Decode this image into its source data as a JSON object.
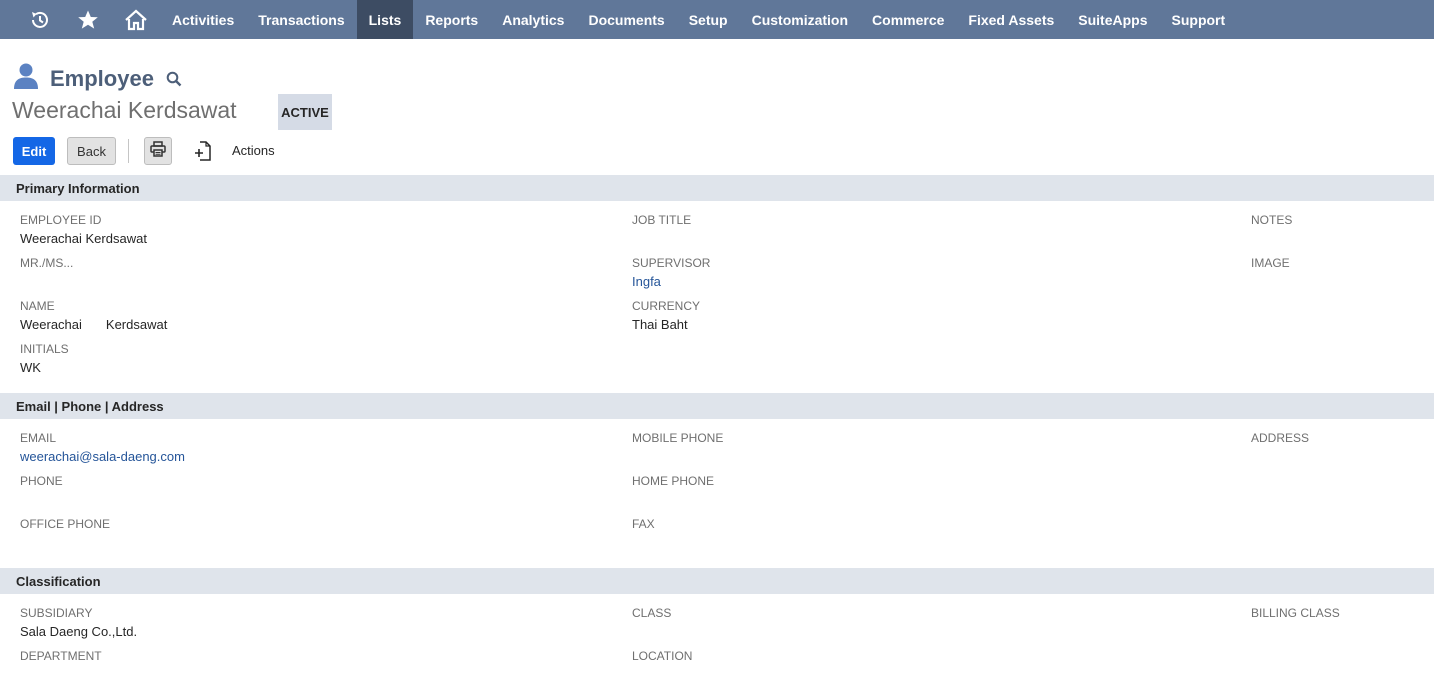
{
  "nav": {
    "icons": [
      "recent-icon",
      "star-icon",
      "home-icon"
    ],
    "items": [
      "Activities",
      "Transactions",
      "Lists",
      "Reports",
      "Analytics",
      "Documents",
      "Setup",
      "Customization",
      "Commerce",
      "Fixed Assets",
      "SuiteApps",
      "Support"
    ],
    "active": "Lists"
  },
  "record": {
    "type": "Employee",
    "name": "Weerachai Kerdsawat",
    "status": "ACTIVE"
  },
  "buttons": {
    "edit": "Edit",
    "back": "Back",
    "actions": "Actions"
  },
  "sections": {
    "primary": {
      "title": "Primary Information",
      "employee_id_label": "EMPLOYEE ID",
      "employee_id_value": "Weerachai Kerdsawat",
      "mr_ms_label": "MR./MS...",
      "name_label": "NAME",
      "first_name": "Weerachai",
      "last_name": "Kerdsawat",
      "initials_label": "INITIALS",
      "initials_value": "WK",
      "job_title_label": "JOB TITLE",
      "supervisor_label": "SUPERVISOR",
      "supervisor_value": "Ingfa",
      "currency_label": "CURRENCY",
      "currency_value": "Thai Baht",
      "notes_label": "NOTES",
      "image_label": "IMAGE"
    },
    "contact": {
      "title": "Email | Phone | Address",
      "email_label": "EMAIL",
      "email_value": "weerachai@sala-daeng.com",
      "phone_label": "PHONE",
      "office_phone_label": "OFFICE PHONE",
      "mobile_phone_label": "MOBILE PHONE",
      "home_phone_label": "HOME PHONE",
      "fax_label": "FAX",
      "address_label": "ADDRESS"
    },
    "classification": {
      "title": "Classification",
      "subsidiary_label": "SUBSIDIARY",
      "subsidiary_value": "Sala Daeng Co.,Ltd.",
      "department_label": "DEPARTMENT",
      "class_label": "CLASS",
      "location_label": "LOCATION",
      "billing_class_label": "BILLING CLASS"
    }
  },
  "colors": {
    "nav_bg": "#607799",
    "nav_active": "#3d4c63",
    "section_bg": "#dfe4eb",
    "link": "#255599",
    "edit_button": "#1467e6"
  }
}
